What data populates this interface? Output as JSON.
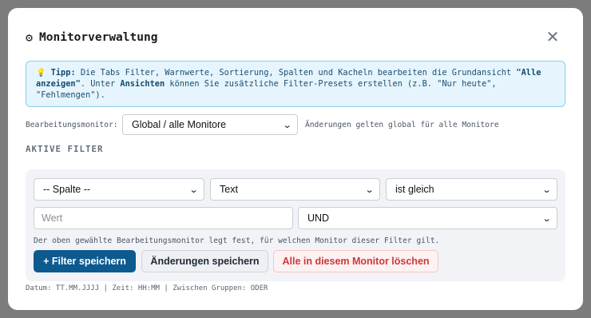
{
  "dialog": {
    "title": "Monitorverwaltung",
    "close_glyph": "✕",
    "gear_glyph": "⚙"
  },
  "tip": {
    "icon_glyph": "💡",
    "label": "Tipp:",
    "text_1": " Die Tabs Filter, Warnwerte, Sortierung, Spalten und Kacheln bearbeiten die Grundansicht ",
    "strong_1": "\"Alle anzeigen\"",
    "text_2": ". Unter ",
    "strong_2": "Ansichten",
    "text_3": " können Sie zusätzliche Filter-Presets erstellen (z.B. \"Nur heute\", \"Fehlmengen\")."
  },
  "monitor": {
    "label": "Bearbeitungsmonitor:",
    "selected": "Global / alle Monitore",
    "hint": "Änderungen gelten global für alle Monitore"
  },
  "filters": {
    "heading": "AKTIVE FILTER",
    "column_select": "-- Spalte --",
    "type_select": "Text",
    "operator_select": "ist gleich",
    "value_placeholder": "Wert",
    "logic_select": "UND",
    "note": "Der oben gewählte Bearbeitungsmonitor legt fest, für welchen Monitor dieser Filter gilt.",
    "buttons": {
      "save_filter": "+ Filter speichern",
      "save_changes": "Änderungen speichern",
      "delete_all": "Alle in diesem Monitor löschen"
    }
  },
  "footer": {
    "text": "Datum: TT.MM.JJJJ | Zeit: HH:MM | Zwischen Gruppen: ODER"
  },
  "colors": {
    "primary": "#0d5a8f",
    "danger": "#d0373a",
    "tip_bg": "#e6f5fd",
    "tip_border": "#8ecbe9"
  }
}
